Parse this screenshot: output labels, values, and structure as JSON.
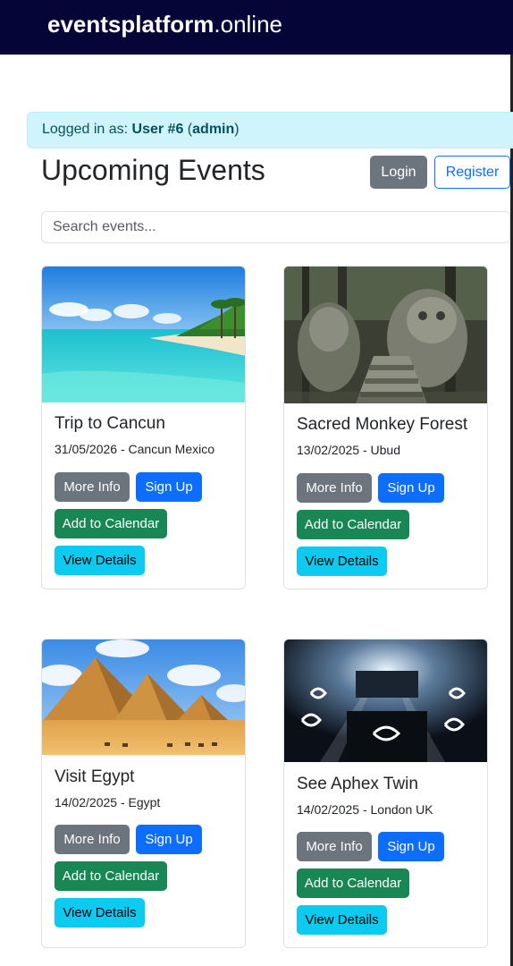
{
  "navbar": {
    "brand_bold": "eventsplatform",
    "brand_rest": ".online"
  },
  "alert": {
    "prefix": "Logged in as: ",
    "user": "User #6",
    "open_paren": " (",
    "role": "admin",
    "close_paren": ")"
  },
  "header": {
    "title": "Upcoming Events",
    "login_label": "Login",
    "register_label": "Register"
  },
  "search": {
    "placeholder": "Search events...",
    "value": ""
  },
  "buttons": {
    "more_info": "More Info",
    "sign_up": "Sign Up",
    "add_calendar": "Add to Calendar",
    "view_details": "View Details"
  },
  "events": [
    {
      "title": "Trip to Cancun",
      "subtitle": "31/05/2026 - Cancun Mexico",
      "image": "beach-photo"
    },
    {
      "title": "Sacred Monkey Forest",
      "subtitle": "13/02/2025 - Ubud",
      "image": "temple-statue-photo"
    },
    {
      "title": "Visit Egypt",
      "subtitle": "14/02/2025 - Egypt",
      "image": "pyramids-photo"
    },
    {
      "title": "See Aphex Twin",
      "subtitle": "14/02/2025 - London UK",
      "image": "concert-photo"
    }
  ],
  "colors": {
    "navbar": "#050537",
    "alert_bg": "#cff4fc",
    "primary": "#0d6efd",
    "secondary": "#6c757d",
    "success": "#198754",
    "info": "#0dcaf0"
  }
}
